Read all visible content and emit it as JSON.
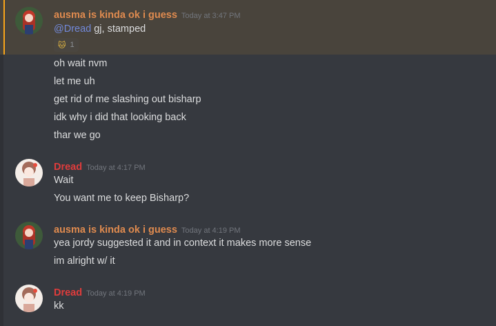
{
  "messages": [
    {
      "author": "ausma is kinda ok i guess",
      "timestamp": "Today at 3:47 PM",
      "mention": "@Dread",
      "first_text": " gj, stamped",
      "reaction": {
        "emoji": "🐱",
        "count": "1"
      },
      "lines": [
        "oh wait nvm",
        "let me uh",
        "get rid of me slashing out bisharp",
        "idk why i did that looking back",
        "thar we go"
      ]
    },
    {
      "author": "Dread",
      "timestamp": "Today at 4:17 PM",
      "lines": [
        "Wait",
        "You want me to keep Bisharp?"
      ]
    },
    {
      "author": "ausma is kinda ok i guess",
      "timestamp": "Today at 4:19 PM",
      "lines": [
        "yea jordy suggested it and in context it makes more sense",
        "im alright w/ it"
      ]
    },
    {
      "author": "Dread",
      "timestamp": "Today at 4:19 PM",
      "lines": [
        "kk"
      ]
    }
  ],
  "colors": {
    "background": "#36393f",
    "mention_highlight": "#49443c",
    "mention_bar": "#faa61a",
    "ausma_name": "#e08b4f",
    "dread_name": "#e03c3c",
    "mention_link": "#7289da"
  },
  "icons": {
    "ausma_avatar": "ausma-avatar",
    "dread_avatar": "dread-avatar"
  }
}
